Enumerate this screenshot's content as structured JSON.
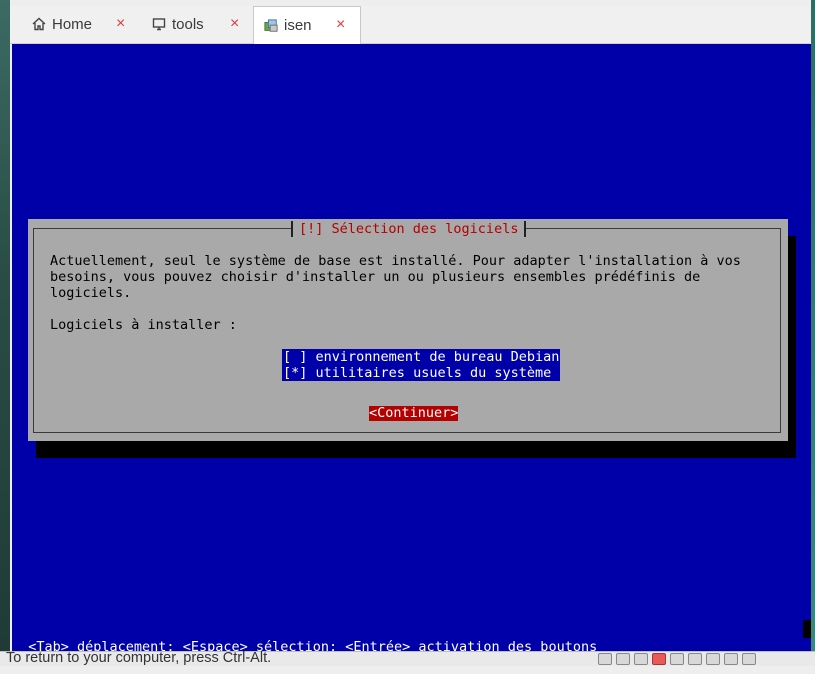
{
  "tabs": [
    {
      "label": "Home",
      "icon": "home-icon",
      "active": false
    },
    {
      "label": "tools",
      "icon": "monitor-icon",
      "active": false
    },
    {
      "label": "isen",
      "icon": "vm-icon",
      "active": true
    }
  ],
  "tab_close_symbol": "×",
  "dialog": {
    "title": "[!] Sélection des logiciels",
    "description_lines": [
      "Actuellement, seul le système de base est installé. Pour adapter l'installation à vos",
      "besoins, vous pouvez choisir d'installer un ou plusieurs ensembles prédéfinis de",
      "logiciels."
    ],
    "prompt": "Logiciels à installer :",
    "options": [
      {
        "marker": "[ ]",
        "label": "environnement de bureau Debian",
        "checked": false
      },
      {
        "marker": "[*]",
        "label": "utilitaires usuels du système",
        "checked": true
      }
    ],
    "continue_button": "<Continuer>"
  },
  "statusbar": "<Tab> déplacement; <Espace> sélection; <Entrée> activation des boutons",
  "bottom_message": "To return to your computer, press Ctrl-Alt.",
  "colors": {
    "console_bg": "#0000a8",
    "dialog_bg": "#aaa9aa",
    "title_red": "#b30000",
    "button_red": "#b30000"
  }
}
